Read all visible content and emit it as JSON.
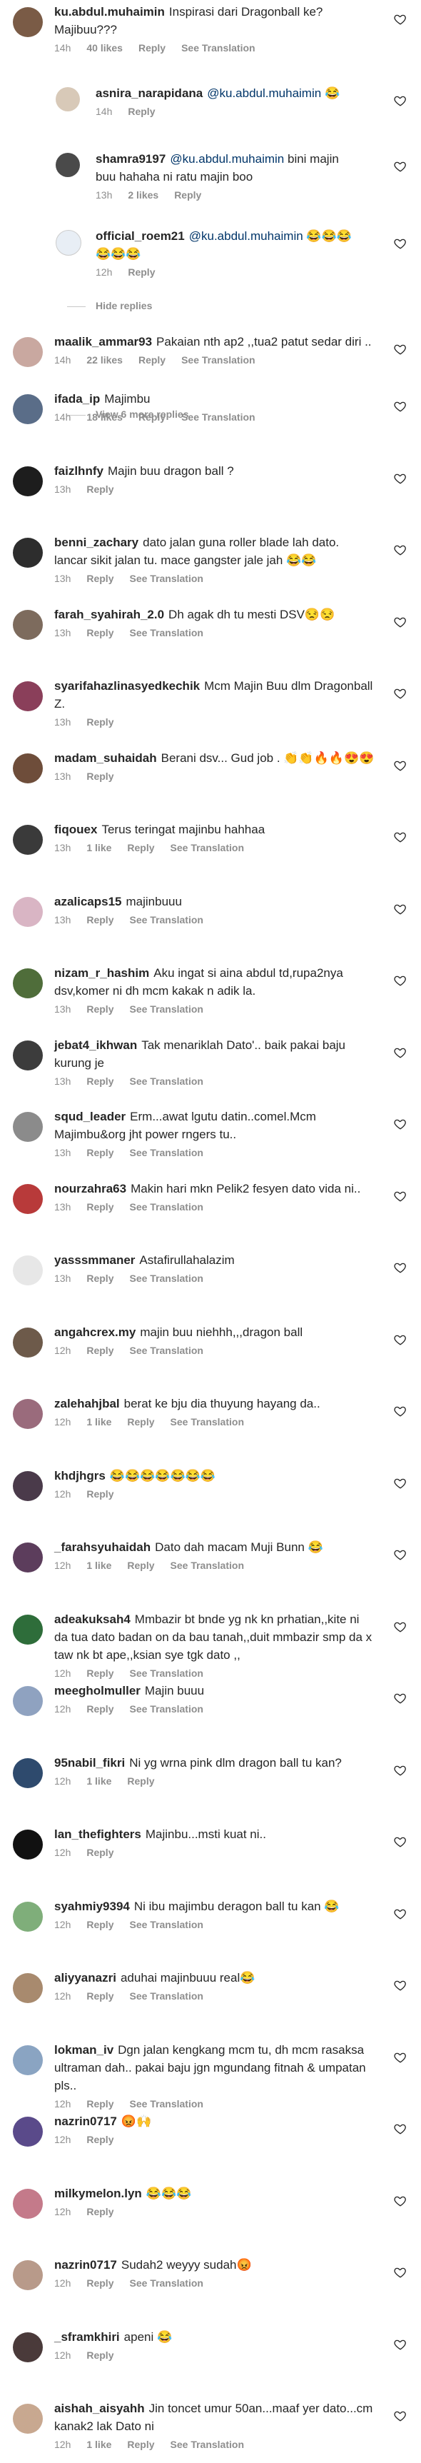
{
  "colors": {
    "text": "#262626",
    "meta": "#8e8e8e",
    "mention": "#003569"
  },
  "comments": [
    {
      "user": "ku.abdul.muhaimin",
      "text": "Inspirasi dari Dragonball ke? Majibuu???",
      "time": "14h",
      "likes": "40 likes",
      "reply": "Reply",
      "translate": "See Translation"
    },
    {
      "user": "asnira_narapidana",
      "mention": "@ku.abdul.muhaimin",
      "text": "😂",
      "time": "14h",
      "likes": "",
      "reply": "Reply",
      "translate": ""
    },
    {
      "user": "shamra9197",
      "mention": "@ku.abdul.muhaimin",
      "text": "bini majin buu hahaha ni ratu majin boo",
      "time": "13h",
      "likes": "2 likes",
      "reply": "Reply",
      "translate": ""
    },
    {
      "user": "official_roem21",
      "mention": "@ku.abdul.muhaimin",
      "text": "😂😂😂😂😂😂",
      "time": "12h",
      "likes": "",
      "reply": "Reply",
      "translate": ""
    },
    {
      "user": "maalik_ammar93",
      "text": "Pakaian nth ap2 ,,tua2 patut sedar diri ..",
      "time": "14h",
      "likes": "22 likes",
      "reply": "Reply",
      "translate": "See Translation"
    },
    {
      "user": "ifada_ip",
      "text": "Majimbu",
      "time": "14h",
      "likes": "18 likes",
      "reply": "Reply",
      "translate": "See Translation"
    },
    {
      "user": "faizlhnfy",
      "text": "Majin buu dragon ball ?",
      "time": "13h",
      "likes": "",
      "reply": "Reply",
      "translate": ""
    },
    {
      "user": "benni_zachary",
      "text": "dato jalan guna roller blade lah dato. lancar sikit jalan tu. mace gangster jale jah 😂😂",
      "time": "13h",
      "likes": "",
      "reply": "Reply",
      "translate": "See Translation"
    },
    {
      "user": "farah_syahirah_2.0",
      "text": "Dh agak dh tu mesti DSV😒😒",
      "time": "13h",
      "likes": "",
      "reply": "Reply",
      "translate": "See Translation"
    },
    {
      "user": "syarifahazlinasyedkechik",
      "text": "Mcm Majin Buu dlm Dragonball Z.",
      "time": "13h",
      "likes": "",
      "reply": "Reply",
      "translate": ""
    },
    {
      "user": "madam_suhaidah",
      "text": "Berani dsv... Gud job . 👏👏🔥🔥😍😍",
      "time": "13h",
      "likes": "",
      "reply": "Reply",
      "translate": ""
    },
    {
      "user": "fiqouex",
      "text": "Terus teringat majinbu hahhaa",
      "time": "13h",
      "likes": "1 like",
      "reply": "Reply",
      "translate": "See Translation"
    },
    {
      "user": "azalicaps15",
      "text": "majinbuuu",
      "time": "13h",
      "likes": "",
      "reply": "Reply",
      "translate": "See Translation"
    },
    {
      "user": "nizam_r_hashim",
      "text": "Aku ingat si aina abdul td,rupa2nya dsv,komer ni dh mcm kakak n adik la.",
      "time": "13h",
      "likes": "",
      "reply": "Reply",
      "translate": "See Translation"
    },
    {
      "user": "jebat4_ikhwan",
      "text": "Tak menariklah Dato'.. baik pakai baju kurung je",
      "time": "13h",
      "likes": "",
      "reply": "Reply",
      "translate": "See Translation"
    },
    {
      "user": "squd_leader",
      "text": "Erm...awat lgutu datin..comel.Mcm Majimbu&org jht power rngers tu..",
      "time": "13h",
      "likes": "",
      "reply": "Reply",
      "translate": "See Translation"
    },
    {
      "user": "nourzahra63",
      "text": "Makin hari mkn Pelik2 fesyen dato vida ni..",
      "time": "13h",
      "likes": "",
      "reply": "Reply",
      "translate": "See Translation"
    },
    {
      "user": "yasssmmaner",
      "text": "Astafirullahalazim",
      "time": "13h",
      "likes": "",
      "reply": "Reply",
      "translate": "See Translation"
    },
    {
      "user": "angahcrex.my",
      "text": "majin buu niehhh,,,dragon ball",
      "time": "12h",
      "likes": "",
      "reply": "Reply",
      "translate": "See Translation"
    },
    {
      "user": "zalehahjbal",
      "text": "berat ke bju dia thuyung hayang da..",
      "time": "12h",
      "likes": "1 like",
      "reply": "Reply",
      "translate": "See Translation"
    },
    {
      "user": "khdjhgrs",
      "text": "😂😂😂😂😂😂😂",
      "time": "12h",
      "likes": "",
      "reply": "Reply",
      "translate": ""
    },
    {
      "user": "_farahsyuhaidah",
      "text": "Dato dah macam Muji Bunn 😂",
      "time": "12h",
      "likes": "1 like",
      "reply": "Reply",
      "translate": "See Translation"
    },
    {
      "user": "adeakuksah4",
      "text": "Mmbazir bt bnde yg nk kn prhatian,,kite ni da tua dato badan on da bau tanah,,duit mmbazir smp da x taw nk bt ape,,ksian sye tgk dato ,,",
      "time": "12h",
      "likes": "",
      "reply": "Reply",
      "translate": "See Translation"
    },
    {
      "user": "meegholmuller",
      "text": "Majin buuu",
      "time": "12h",
      "likes": "",
      "reply": "Reply",
      "translate": "See Translation"
    },
    {
      "user": "95nabil_fikri",
      "text": "Ni yg wrna pink dlm dragon ball tu kan?",
      "time": "12h",
      "likes": "1 like",
      "reply": "Reply",
      "translate": ""
    },
    {
      "user": "lan_thefighters",
      "text": "Majinbu...msti kuat ni..",
      "time": "12h",
      "likes": "",
      "reply": "Reply",
      "translate": ""
    },
    {
      "user": "syahmiy9394",
      "text": "Ni ibu majimbu deragon ball tu kan 😂",
      "time": "12h",
      "likes": "",
      "reply": "Reply",
      "translate": "See Translation"
    },
    {
      "user": "aliyyanazri",
      "text": "aduhai majinbuuu real😂",
      "time": "12h",
      "likes": "",
      "reply": "Reply",
      "translate": "See Translation"
    },
    {
      "user": "lokman_iv",
      "text": "Dgn jalan kengkang mcm tu, dh mcm rasaksa ultraman dah.. pakai baju jgn mgundang fitnah & umpatan pls..",
      "time": "12h",
      "likes": "",
      "reply": "Reply",
      "translate": "See Translation"
    },
    {
      "user": "nazrin0717",
      "text": "😡🙌",
      "time": "12h",
      "likes": "",
      "reply": "Reply",
      "translate": ""
    },
    {
      "user": "milkymelon.lyn",
      "text": "😂😂😂",
      "time": "12h",
      "likes": "",
      "reply": "Reply",
      "translate": ""
    },
    {
      "user": "nazrin0717",
      "text": "Sudah2 weyyy sudah😡",
      "time": "12h",
      "likes": "",
      "reply": "Reply",
      "translate": "See Translation"
    },
    {
      "user": "_sframkhiri",
      "text": "apeni 😂",
      "time": "12h",
      "likes": "",
      "reply": "Reply",
      "translate": ""
    },
    {
      "user": "aishah_aisyahh",
      "text": "Jin toncet umur 50an...maaf yer dato...cm kanak2 lak Dato ni",
      "time": "12h",
      "likes": "1 like",
      "reply": "Reply",
      "translate": "See Translation"
    }
  ],
  "hide_replies": "Hide replies",
  "view_more": "View 6 more replies"
}
